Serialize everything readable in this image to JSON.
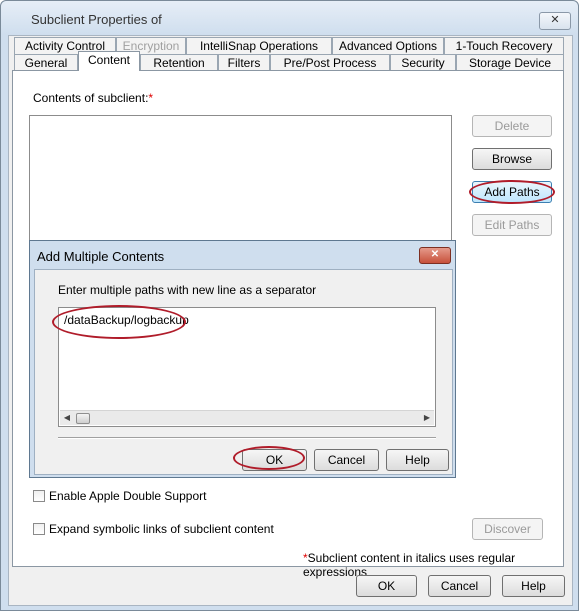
{
  "window": {
    "title": "Subclient Properties of",
    "close_symbol": "✕"
  },
  "tabs": {
    "row1": [
      {
        "label": "Activity Control",
        "disabled": false
      },
      {
        "label": "Encryption",
        "disabled": true
      },
      {
        "label": "IntelliSnap Operations",
        "disabled": false
      },
      {
        "label": "Advanced Options",
        "disabled": false
      },
      {
        "label": "1-Touch Recovery",
        "disabled": false
      }
    ],
    "row2": [
      {
        "label": "General"
      },
      {
        "label": "Content",
        "active": true
      },
      {
        "label": "Retention"
      },
      {
        "label": "Filters"
      },
      {
        "label": "Pre/Post Process"
      },
      {
        "label": "Security"
      },
      {
        "label": "Storage Device"
      }
    ]
  },
  "content": {
    "contents_label": "Contents of subclient:",
    "required_mark": "*",
    "buttons": {
      "delete": "Delete",
      "browse": "Browse",
      "add_paths": "Add Paths",
      "edit_paths": "Edit Paths",
      "discover": "Discover"
    },
    "apple_double_label": "Enable Apple Double Support",
    "apple_double_checked": false,
    "symlinks_label": "Expand symbolic links of subclient content",
    "symlinks_checked": false,
    "footnote_mark": "*",
    "footnote": "Subclient content in italics uses regular expressions"
  },
  "dialog": {
    "title": "Add Multiple Contents",
    "close_symbol": "✕",
    "instruction": "Enter multiple paths with new line as a separator",
    "paths_value": "/dataBackup/logbackup",
    "buttons": {
      "ok": "OK",
      "cancel": "Cancel",
      "help": "Help"
    }
  },
  "footer_buttons": {
    "ok": "OK",
    "cancel": "Cancel",
    "help": "Help"
  },
  "colors": {
    "highlight_ring": "#b01c2a",
    "required": "#dd0000"
  }
}
